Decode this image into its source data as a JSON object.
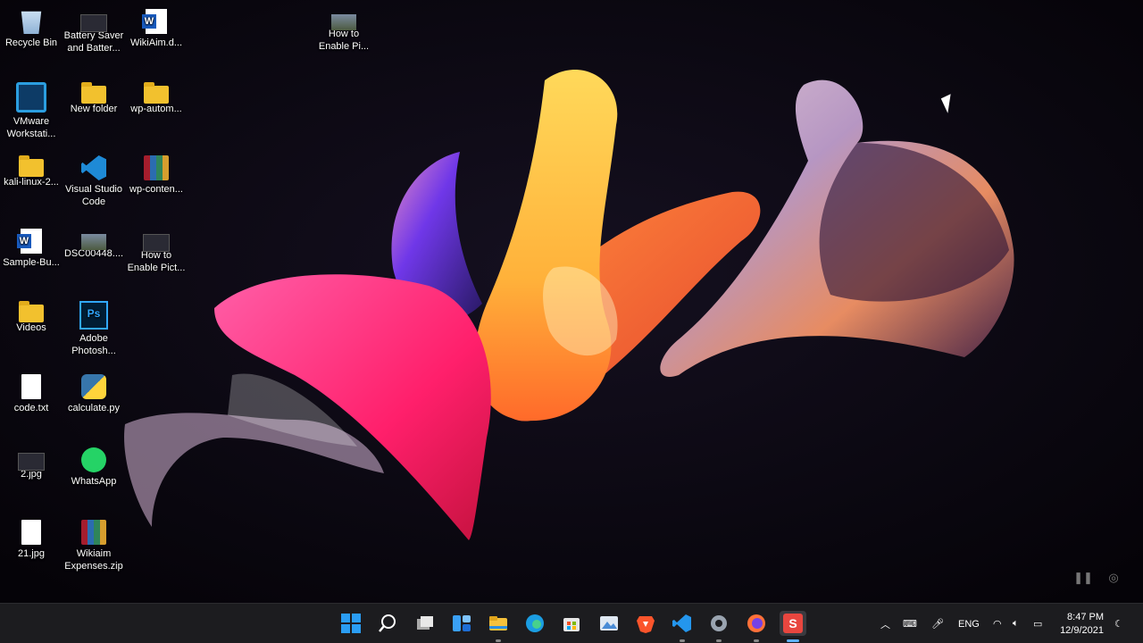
{
  "desktop": {
    "icons": [
      {
        "label": "Recycle Bin"
      },
      {
        "label": "Battery Saver and Batter..."
      },
      {
        "label": "WikiAim.d..."
      },
      {
        "label": "How to Enable Pi..."
      },
      {
        "label": "VMware Workstati..."
      },
      {
        "label": "New folder"
      },
      {
        "label": "wp-autom..."
      },
      {
        "label": "kali-linux-2..."
      },
      {
        "label": "Visual Studio Code"
      },
      {
        "label": "wp-conten..."
      },
      {
        "label": "Sample-Bu..."
      },
      {
        "label": "DSC00448...."
      },
      {
        "label": "How to Enable Pict..."
      },
      {
        "label": "Videos"
      },
      {
        "label": "Adobe Photosh..."
      },
      {
        "label": "code.txt"
      },
      {
        "label": "calculate.py"
      },
      {
        "label": "2.jpg"
      },
      {
        "label": "WhatsApp"
      },
      {
        "label": "21.jpg"
      },
      {
        "label": "Wikiaim Expenses.zip"
      }
    ]
  },
  "taskbar": {
    "apps": [
      "start-icon",
      "search-icon",
      "task-view-icon",
      "widgets-icon",
      "file-explorer-icon",
      "edge-icon",
      "store-icon",
      "photos-icon",
      "brave-icon",
      "vscode-icon",
      "settings-icon",
      "firefox-icon",
      "snagit-icon"
    ],
    "language": "ENG",
    "time": "8:47 PM",
    "date": "12/9/2021"
  },
  "colors": {
    "taskbar": "#1c1c1f",
    "accent": "#0078d4"
  }
}
